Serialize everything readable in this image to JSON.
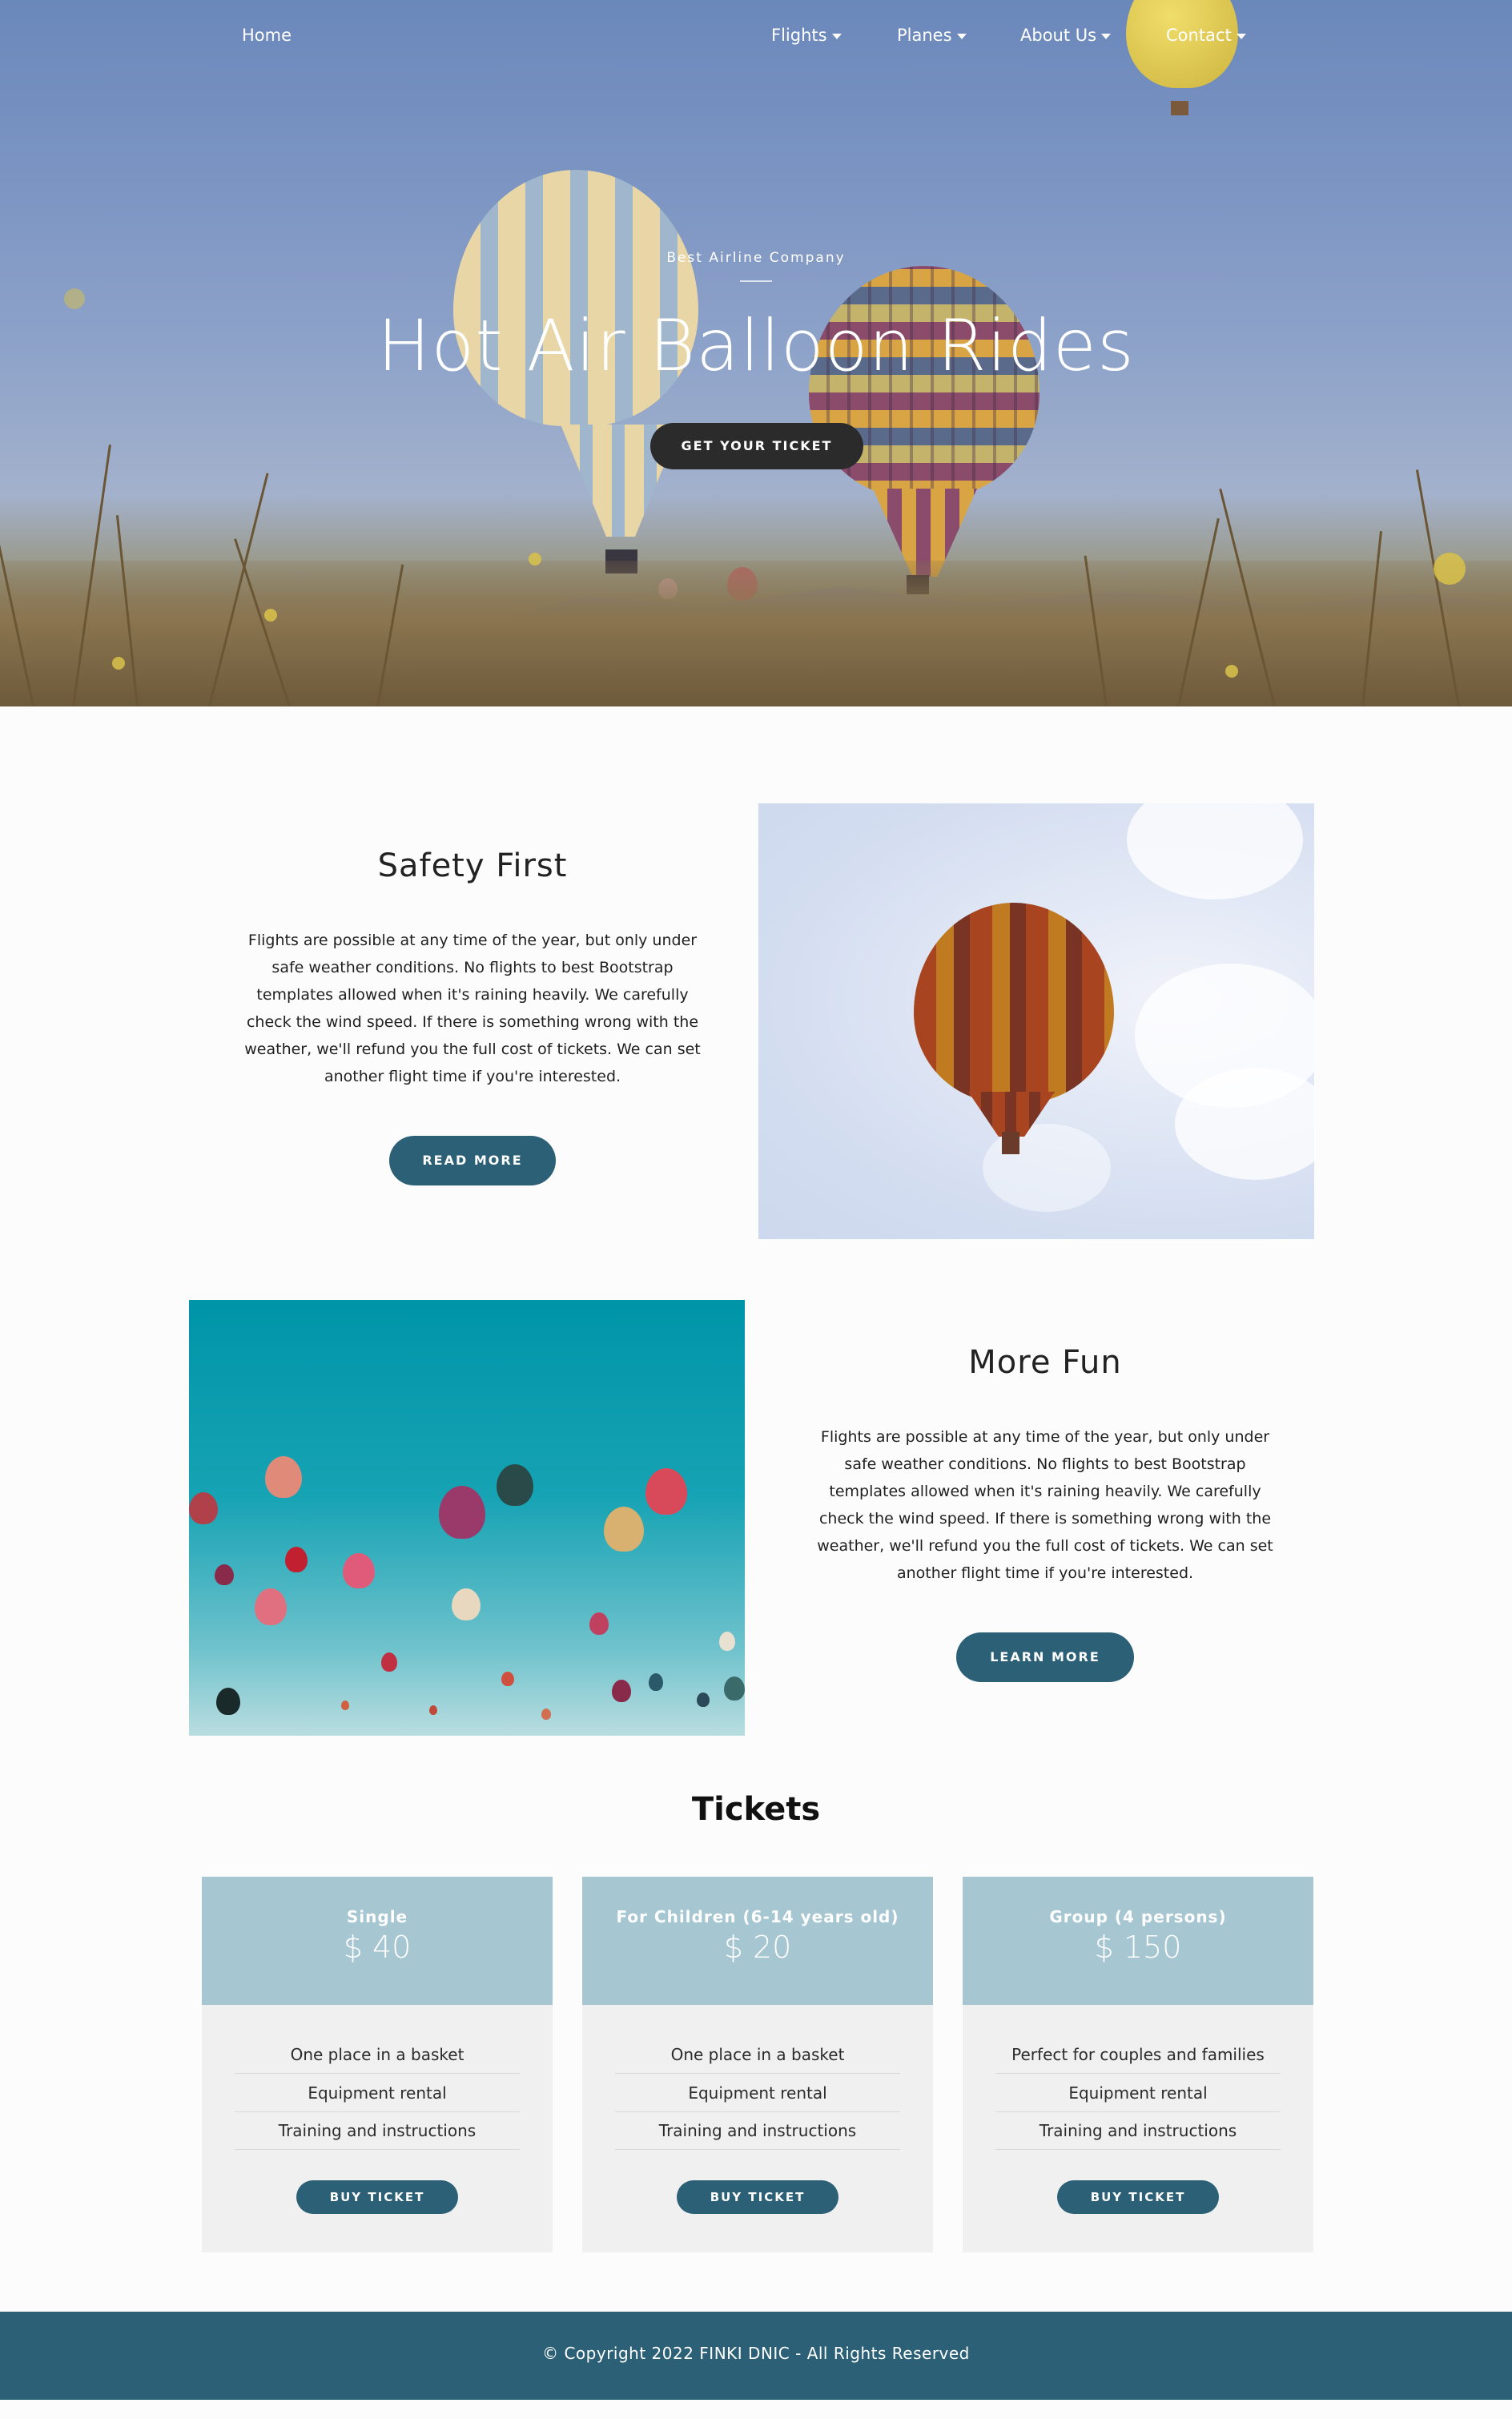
{
  "nav": {
    "home": "Home",
    "flights": "Flights",
    "planes": "Planes",
    "about": "About Us",
    "contact": "Contact"
  },
  "hero": {
    "subtitle": "Best Airline Company",
    "title": "Hot Air Balloon Rides",
    "button": "GET YOUR TICKET"
  },
  "section1": {
    "title": "Safety First",
    "text": "Flights are possible at any time of the year, but only under safe weather conditions. No flights to best Bootstrap templates allowed when it's raining heavily. We carefully check the wind speed. If there is something wrong with the weather, we'll refund you the full cost of tickets. We can set another flight time if you're interested.",
    "button": "READ MORE"
  },
  "section2": {
    "title": "More Fun",
    "text": "Flights are possible at any time of the year, but only under safe weather conditions. No flights to best Bootstrap templates allowed when it's raining heavily. We carefully check the wind speed. If there is something wrong with the weather, we'll refund you the full cost of tickets. We can set another flight time if you're interested.",
    "button": "LEARN MORE"
  },
  "tickets": {
    "title": "Tickets",
    "cards": [
      {
        "name": "Single",
        "price": "$ 40",
        "features": [
          "One place in a basket",
          "Equipment rental",
          "Training and instructions"
        ],
        "button": "BUY TICKET"
      },
      {
        "name": "For Children (6-14 years old)",
        "price": "$ 20",
        "features": [
          "One place in a basket",
          "Equipment rental",
          "Training and instructions"
        ],
        "button": "BUY TICKET"
      },
      {
        "name": "Group (4 persons)",
        "price": "$ 150",
        "features": [
          "Perfect for couples and families",
          "Equipment rental",
          "Training and instructions"
        ],
        "button": "BUY TICKET"
      }
    ]
  },
  "footer": {
    "text": "© Copyright 2022 FINKI DNIC - All Rights Reserved"
  },
  "colors": {
    "accent": "#2b6076",
    "card_header": "#a6c6d2",
    "hero_button": "#2b2b2b"
  },
  "icons": {
    "dropdown": "caret-down-icon"
  }
}
